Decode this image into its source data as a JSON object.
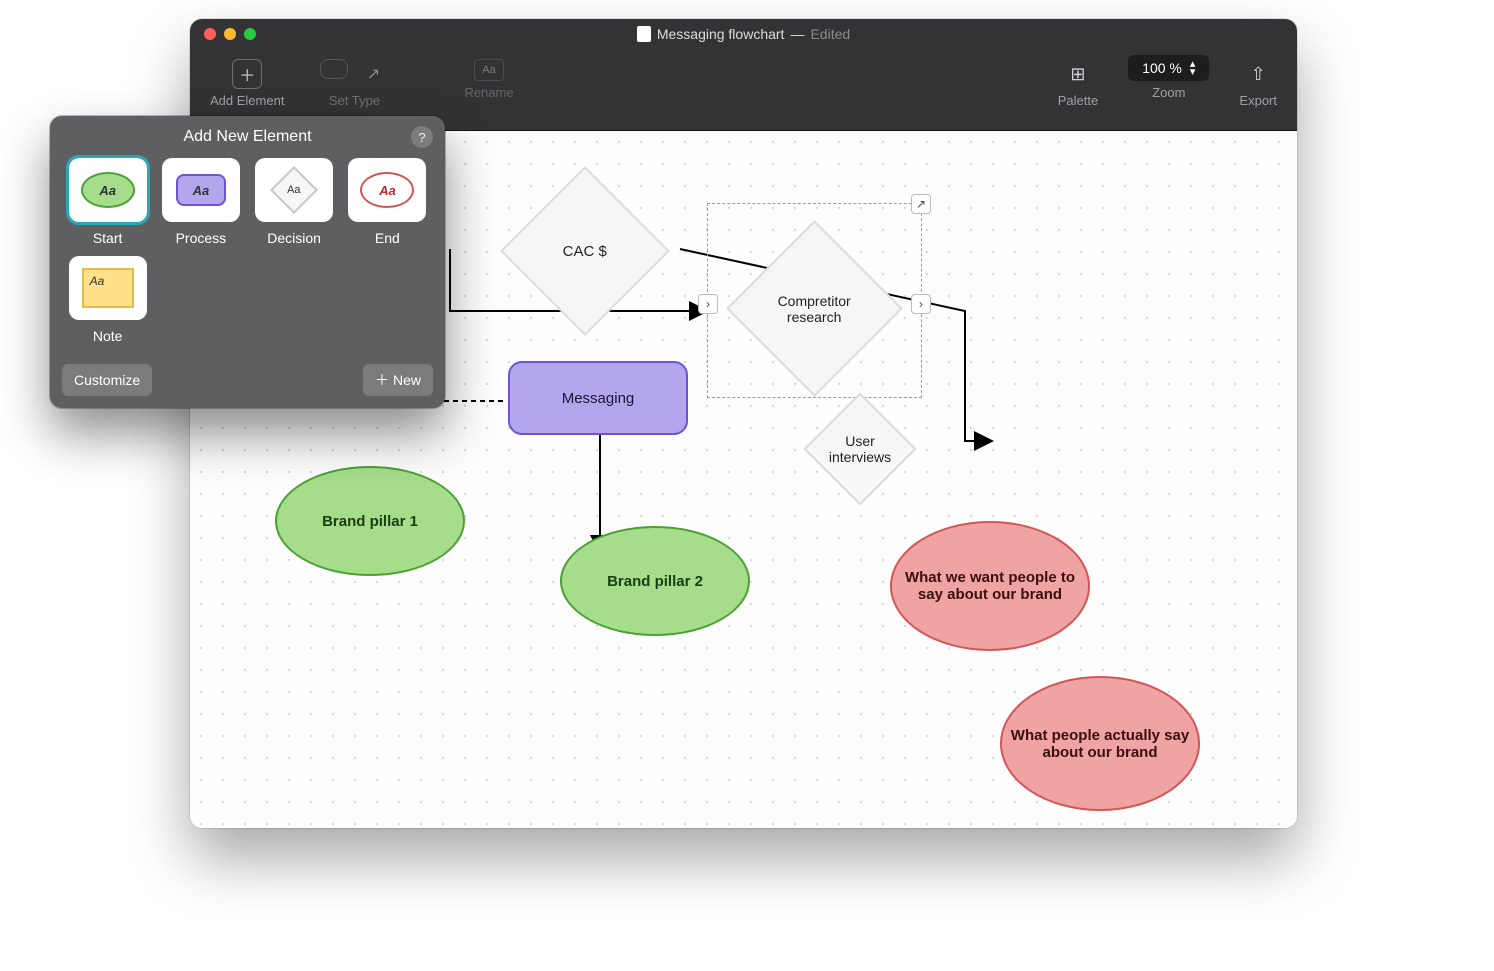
{
  "window": {
    "title": "Messaging flowchart",
    "status": "Edited"
  },
  "toolbar": {
    "add_element": "Add Element",
    "set_type": "Set Type",
    "rename": "Rename",
    "palette": "Palette",
    "zoom_label": "Zoom",
    "zoom_value": "100 %",
    "export": "Export"
  },
  "popover": {
    "title": "Add New Element",
    "customize": "Customize",
    "new": "New",
    "glyph": "Aa",
    "items": [
      {
        "label": "Start"
      },
      {
        "label": "Process"
      },
      {
        "label": "Decision"
      },
      {
        "label": "End"
      },
      {
        "label": "Note"
      }
    ]
  },
  "nodes": {
    "cac": "CAC $",
    "competitor": "Compretitor research",
    "messaging": "Messaging",
    "user_interviews": "User interviews",
    "pillar1": "Brand pillar 1",
    "pillar2": "Brand pillar 2",
    "want_say": "What we want people to say about our brand",
    "actually_say": "What people actually say about our brand"
  }
}
